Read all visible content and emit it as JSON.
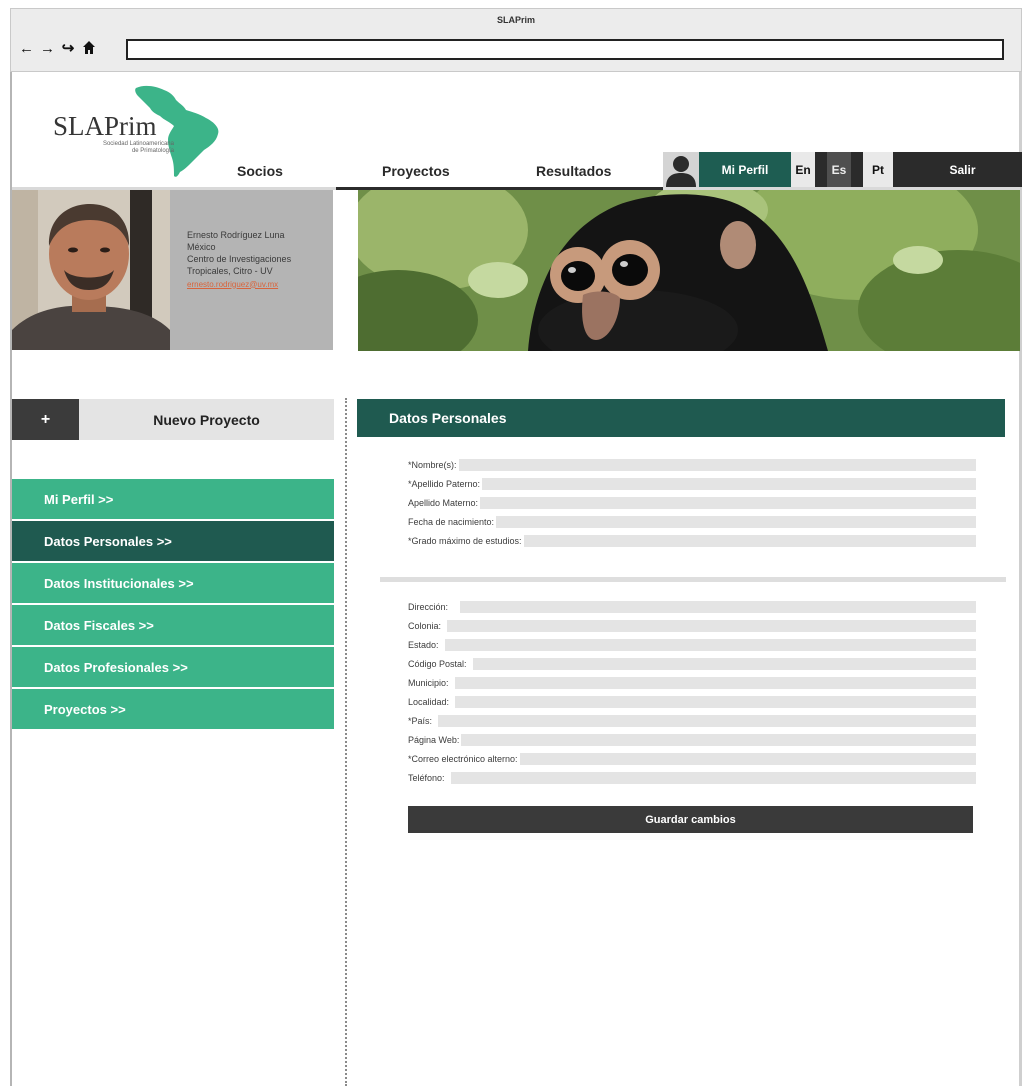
{
  "browser": {
    "title": "SLAPrim",
    "url": ""
  },
  "logo": {
    "name": "SLAPrim",
    "subtitle_line1": "Sociedad Latinoamericana",
    "subtitle_line2": "de Primatología"
  },
  "nav": {
    "items": [
      "Socios",
      "Proyectos",
      "Resultados"
    ]
  },
  "user_bar": {
    "profile": "Mi Perfil",
    "languages": [
      "En",
      "Es",
      "Pt"
    ],
    "active_language": "Es",
    "logout": "Salir"
  },
  "profile": {
    "name": "Ernesto Rodríguez Luna",
    "country": "México",
    "institution_line1": "Centro de Investigaciones",
    "institution_line2": "Tropicales, Citro - UV",
    "email": "ernesto.rodriguez@uv.mx"
  },
  "sidebar": {
    "new_project_icon": "+",
    "new_project_label": "Nuevo Proyecto",
    "items": [
      {
        "label": "Mi Perfil >>"
      },
      {
        "label": "Datos Personales >>"
      },
      {
        "label": "Datos Institucionales >>"
      },
      {
        "label": "Datos Fiscales >>"
      },
      {
        "label": "Datos Profesionales >>"
      },
      {
        "label": "Proyectos >>"
      }
    ],
    "active_index": 1
  },
  "form": {
    "section_title": "Datos Personales",
    "personal_fields": [
      {
        "label": "*Nombre(s):",
        "value": ""
      },
      {
        "label": "*Apellido Paterno:",
        "value": ""
      },
      {
        "label": "Apellido Materno:",
        "value": ""
      },
      {
        "label": "Fecha de nacimiento:",
        "value": ""
      },
      {
        "label": "*Grado máximo de estudios:",
        "value": ""
      }
    ],
    "address_fields": [
      {
        "label": "Dirección:",
        "value": ""
      },
      {
        "label": "Colonia:",
        "value": ""
      },
      {
        "label": "Estado:",
        "value": ""
      },
      {
        "label": "Código Postal:",
        "value": ""
      },
      {
        "label": "Municipio:",
        "value": ""
      },
      {
        "label": "Localidad:",
        "value": ""
      },
      {
        "label": "*País:",
        "value": ""
      },
      {
        "label": "Página Web:",
        "value": ""
      },
      {
        "label": "*Correo electrónico alterno:",
        "value": ""
      },
      {
        "label": "Teléfono:",
        "value": ""
      }
    ],
    "save_label": "Guardar cambios"
  },
  "colors": {
    "dark_green": "#1f5a50",
    "menu_green": "#3cb489",
    "dark_gray": "#2b2b2b",
    "email_orange": "#d8643c"
  },
  "icons": {
    "back": "back-arrow-icon",
    "forward": "forward-arrow-icon",
    "reload": "reload-icon",
    "home": "home-icon",
    "user": "user-silhouette-icon",
    "plus": "plus-icon"
  }
}
